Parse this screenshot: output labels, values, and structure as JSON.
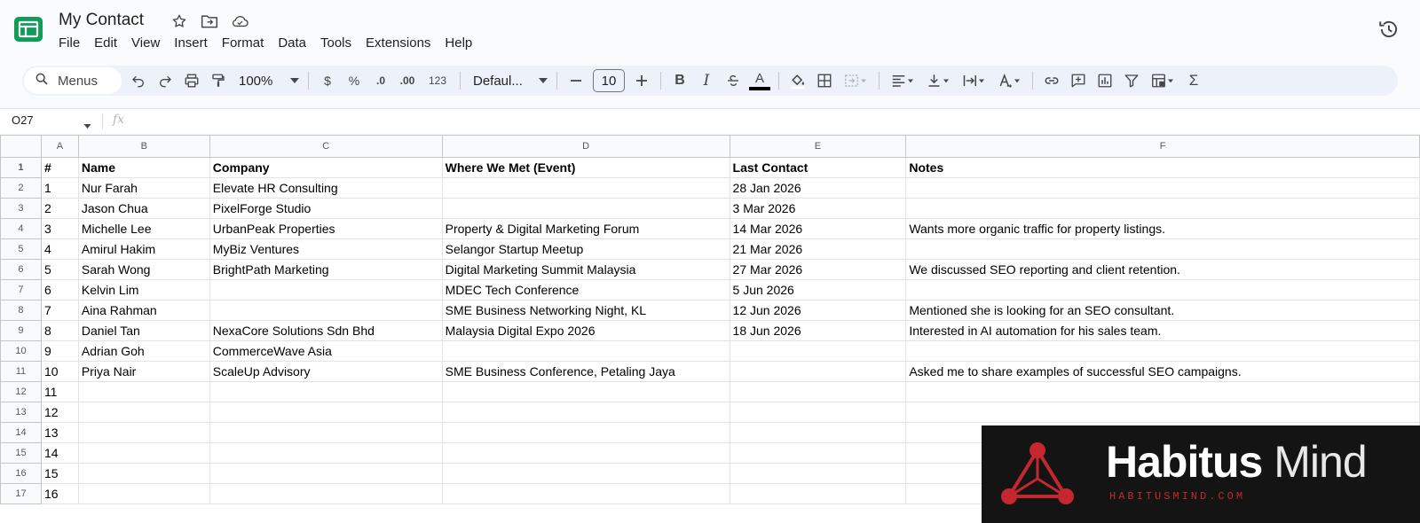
{
  "app": {
    "doc_title": "My Contact",
    "menu": [
      "File",
      "Edit",
      "View",
      "Insert",
      "Format",
      "Data",
      "Tools",
      "Extensions",
      "Help"
    ],
    "accent_color": "#0f9d58"
  },
  "toolbar": {
    "search_label": "Menus",
    "zoom": "100%",
    "currency": "$",
    "percent": "%",
    "decrease_decimal": ".0",
    "increase_decimal": ".00",
    "number_format": "123",
    "font": "Defaul...",
    "font_size": "10",
    "bold": "B",
    "italic": "I",
    "text_color_glyph": "A",
    "sum": "Σ"
  },
  "formula_bar": {
    "cell_ref": "O27",
    "fx_label": "fx"
  },
  "sheet": {
    "columns": [
      "A",
      "B",
      "C",
      "D",
      "E",
      "F"
    ],
    "header": [
      "#",
      "Name",
      "Company",
      "Where We Met (Event)",
      "Last Contact",
      "Notes"
    ],
    "rows": [
      [
        "1",
        "Nur Farah",
        "Elevate HR Consulting",
        "",
        "28 Jan 2026",
        ""
      ],
      [
        "2",
        "Jason Chua",
        "PixelForge Studio",
        "",
        "3 Mar 2026",
        ""
      ],
      [
        "3",
        "Michelle Lee",
        "UrbanPeak Properties",
        "Property & Digital Marketing Forum",
        "14 Mar 2026",
        "Wants more organic traffic for property listings."
      ],
      [
        "4",
        "Amirul Hakim",
        "MyBiz Ventures",
        "Selangor Startup Meetup",
        "21 Mar 2026",
        ""
      ],
      [
        "5",
        "Sarah Wong",
        "BrightPath Marketing",
        "Digital Marketing Summit Malaysia",
        "27 Mar 2026",
        "We discussed SEO reporting and client retention."
      ],
      [
        "6",
        "Kelvin Lim",
        "",
        "MDEC Tech Conference",
        "5 Jun 2026",
        ""
      ],
      [
        "7",
        "Aina Rahman",
        "",
        "SME Business Networking Night, KL",
        "12 Jun 2026",
        "Mentioned she is looking for an SEO consultant."
      ],
      [
        "8",
        "Daniel Tan",
        "NexaCore Solutions Sdn Bhd",
        "Malaysia Digital Expo 2026",
        "18 Jun 2026",
        "Interested in AI automation for his sales team."
      ],
      [
        "9",
        "Adrian Goh",
        "CommerceWave Asia",
        "",
        "",
        ""
      ],
      [
        "10",
        "Priya Nair",
        "ScaleUp Advisory",
        "SME Business Conference, Petaling Jaya",
        "",
        "Asked me to share examples of successful SEO campaigns."
      ],
      [
        "11",
        "",
        "",
        "",
        "",
        ""
      ],
      [
        "12",
        "",
        "",
        "",
        "",
        ""
      ],
      [
        "13",
        "",
        "",
        "",
        "",
        ""
      ],
      [
        "14",
        "",
        "",
        "",
        "",
        ""
      ],
      [
        "15",
        "",
        "",
        "",
        "",
        ""
      ],
      [
        "16",
        "",
        "",
        "",
        "",
        ""
      ]
    ]
  },
  "watermark": {
    "name_bold": "Habitus",
    "name_light": "Mind",
    "url": "HABITUSMIND.COM",
    "accent_color": "#c4282e"
  }
}
